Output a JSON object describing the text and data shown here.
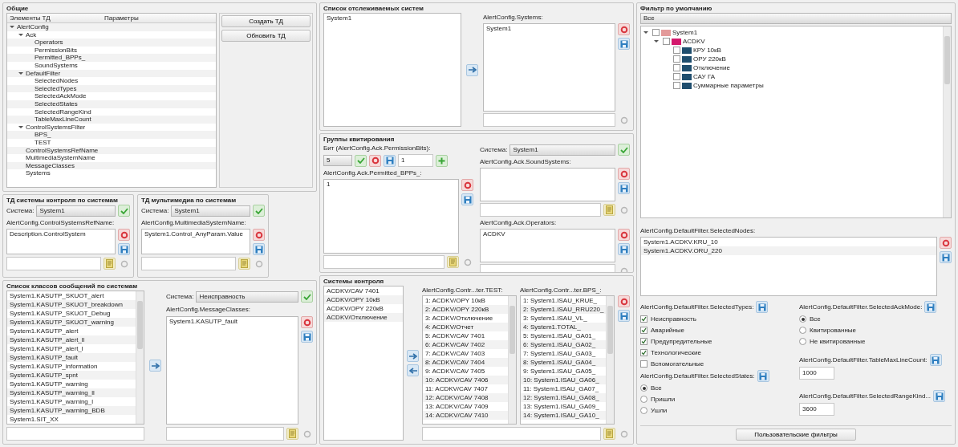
{
  "general": {
    "title": "Общие",
    "tree_columns": [
      "Элементы ТД",
      "Параметры"
    ],
    "tree": [
      {
        "label": "AlertConfig",
        "expanded": true,
        "children": [
          {
            "label": "Ack",
            "expanded": true,
            "children": [
              {
                "label": "Operators"
              },
              {
                "label": "PermissionBits"
              },
              {
                "label": "Permitted_BPPs_"
              },
              {
                "label": "SoundSystems"
              }
            ]
          },
          {
            "label": "DefaultFilter",
            "expanded": true,
            "children": [
              {
                "label": "SelectedNodes"
              },
              {
                "label": "SelectedTypes"
              },
              {
                "label": "SelectedAckMode"
              },
              {
                "label": "SelectedStates"
              },
              {
                "label": "SelectedRangeKind"
              },
              {
                "label": "TableMaxLineCount"
              }
            ]
          },
          {
            "label": "ControlSystemsFilter",
            "expanded": true,
            "children": [
              {
                "label": "BPS_"
              },
              {
                "label": "TEST"
              }
            ]
          },
          {
            "label": "ControlSystemsRefName"
          },
          {
            "label": "MultimediaSystemName"
          },
          {
            "label": "MessageClasses"
          },
          {
            "label": "Systems"
          }
        ]
      }
    ],
    "buttons": [
      "Создать ТД",
      "Обновить ТД"
    ]
  },
  "control_system_td": {
    "title": "ТД системы контроля по системам",
    "system_label": "Система:",
    "system": "System1",
    "list_label": "AlertConfig.ControlSystemsRefName:",
    "items": [
      "Description.ControlSystem"
    ]
  },
  "multimedia_td": {
    "title": "ТД мультимедиа по системам",
    "system_label": "Система:",
    "system": "System1",
    "list_label": "AlertConfig.MultimediaSystemName:",
    "items": [
      "System1.Control_AnyParam.Value"
    ]
  },
  "message_classes": {
    "title": "Список классов сообщений по системам",
    "source_items": [
      "System1.KASUTP_SKUOT_alert",
      "System1.KASUTP_SKUOT_breakdown",
      "System1.KASUTP_SKUOT_Debug",
      "System1.KASUTP_SKUOT_warning",
      "System1.KASUTP_alert",
      "System1.KASUTP_alert_ll",
      "System1.KASUTP_alert_l",
      "System1.KASUTP_fault",
      "System1.KASUTP_information",
      "System1.KASUTP_spnt",
      "System1.KASUTP_warning",
      "System1.KASUTP_warning_ll",
      "System1.KASUTP_warning_l",
      "System1.KASUTP_warning_BDB",
      "System1.SIT_XX"
    ],
    "system_label": "Система:",
    "system": "Неисправность",
    "list_label": "AlertConfig.MessageClasses:",
    "items": [
      "System1.KASUTP_fault"
    ]
  },
  "monitored_systems": {
    "title": "Список отслеживаемых систем",
    "source_items": [
      "System1"
    ],
    "list_label": "AlertConfig.Systems:",
    "items": [
      "System1"
    ]
  },
  "ack_groups": {
    "title": "Группы квитирования",
    "bit_label": "Бит (AlertConfig.Ack.PermissionBits):",
    "bit_value": "5",
    "index_value": "1",
    "bpps_label": "AlertConfig.Ack.Permitted_BPPs_:",
    "bpps_items": [
      "1"
    ],
    "system_label": "Система:",
    "system": "System1",
    "sound_label": "AlertConfig.Ack.SoundSystems:",
    "operators_label": "AlertConfig.Ack.Operators:",
    "operators_items": [
      "ACDKV"
    ]
  },
  "control_systems": {
    "title": "Системы контроля",
    "source_items": [
      "ACDKV/CAV 7401",
      "ACDKV/OPY 10кВ",
      "ACDKV/OPY 220кВ",
      "ACDKV/Отключение"
    ],
    "columns": [
      {
        "label": "AlertConfig.Contr...ter.TEST:",
        "items": [
          "1: ACDKV/OPY 10кВ",
          "2: ACDKV/OPY 220кВ",
          "3: ACDKV/Отключение",
          "4: ACDKV/Отчет",
          "5: ACDKV/CAV 7401",
          "6: ACDKV/CAV 7402",
          "7: ACDKV/CAV 7403",
          "8: ACDKV/CAV 7404",
          "9: ACDKV/CAV 7405",
          "10: ACDKV/CAV 7406",
          "11: ACDKV/CAV 7407",
          "12: ACDKV/CAV 7408",
          "13: ACDKV/CAV 7409",
          "14: ACDKV/CAV 7410"
        ]
      },
      {
        "label": "AlertConfig.Contr...ter.BPS_:",
        "items": [
          "1: System1.ISAU_KRUE_",
          "2: System1.ISAU_RRU220_",
          "3: System1.ISAU_VL_",
          "4: System1.TOTAL_",
          "5: System1.ISAU_GA01_",
          "6: System1.ISAU_GA02_",
          "7: System1.ISAU_GA03_",
          "8: System1.ISAU_GA04_",
          "9: System1.ISAU_GA05_",
          "10: System1.ISAU_GA06_",
          "11: System1.ISAU_GA07_",
          "12: System1.ISAU_GA08_",
          "13: System1.ISAU_GA09_",
          "14: System1.ISAU_GA10_"
        ]
      }
    ]
  },
  "default_filter": {
    "title": "Фильтр по умолчанию",
    "filter": "Все",
    "tree": [
      {
        "label": "System1",
        "checked": false,
        "color": "#e39a9a",
        "expanded": true,
        "children": [
          {
            "label": "ACDKV",
            "checked": false,
            "color": "#d4186c",
            "expanded": true,
            "children": [
              {
                "label": "КРУ 10кВ",
                "checked": false,
                "color": "#1f4e6e"
              },
              {
                "label": "ОРУ 220кВ",
                "checked": false,
                "color": "#1f4e6e"
              },
              {
                "label": "Отключение",
                "checked": false,
                "color": "#1f4e6e"
              },
              {
                "label": "САУ ГА",
                "checked": false,
                "color": "#1f4e6e"
              },
              {
                "label": "Суммарные параметры",
                "checked": false,
                "color": "#1f4e6e"
              }
            ]
          }
        ]
      }
    ],
    "nodes_label": "AlertConfig.DefaultFilter.SelectedNodes:",
    "nodes_items": [
      "System1.ACDKV.KRU_10",
      "System1.ACDKV.ORU_220"
    ],
    "types_label": "AlertConfig.DefaultFilter.SelectedTypes:",
    "types": [
      {
        "label": "Неисправность",
        "checked": true
      },
      {
        "label": "Аварийные",
        "checked": true
      },
      {
        "label": "Предупредительные",
        "checked": true
      },
      {
        "label": "Технологические",
        "checked": true
      },
      {
        "label": "Вспомогательные",
        "checked": false
      }
    ],
    "states_label": "AlertConfig.DefaultFilter.SelectedStates:",
    "states": [
      {
        "label": "Все",
        "selected": true
      },
      {
        "label": "Пришли",
        "selected": false
      },
      {
        "label": "Ушли",
        "selected": false
      }
    ],
    "ack_mode_label": "AlertConfig.DefaultFilter.SelectedAckMode:",
    "ack_modes": [
      {
        "label": "Все",
        "selected": true
      },
      {
        "label": "Квитированные",
        "selected": false
      },
      {
        "label": "Не квитированные",
        "selected": false
      }
    ],
    "max_lines_label": "AlertConfig.DefaultFilter.TableMaxLineCount:",
    "max_lines": "1000",
    "range_label": "AlertConfig.DefaultFilter.SelectedRangeKind...",
    "range": "3600",
    "button": "Пользовательские фильтры"
  }
}
